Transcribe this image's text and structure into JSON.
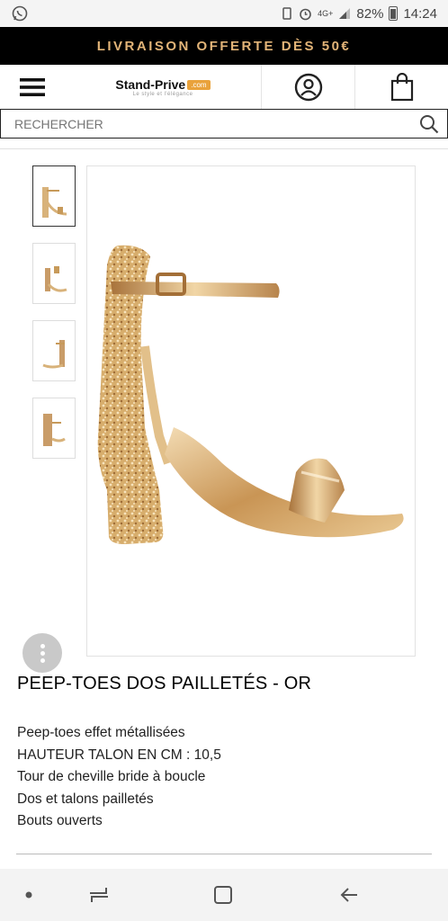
{
  "status_bar": {
    "battery": "82%",
    "time": "14:24",
    "network": "4G+"
  },
  "promo": {
    "text": "LIVRAISON OFFERTE DÈS 50€"
  },
  "header": {
    "logo_name": "Stand-Prive",
    "logo_badge": ".com",
    "logo_tagline": "Le style et l'élégance"
  },
  "search": {
    "placeholder": "RECHERCHER"
  },
  "gallery": {
    "thumbnail_count": 4,
    "image_alt": "gold glitter heel sandal"
  },
  "product": {
    "title": "PEEP-TOES DOS PAILLETÉS - OR",
    "description": [
      "Peep-toes effet métallisées",
      "HAUTEUR TALON EN CM : 10,5",
      "Tour de cheville bride à boucle",
      "Dos et talons pailletés",
      "Bouts ouverts"
    ]
  },
  "colors": {
    "promo_bg": "#000000",
    "promo_text": "#e2b478",
    "logo_badge": "#e9a23b",
    "shoe_gold": "#d8b27a"
  },
  "icons": {
    "menu": "hamburger-icon",
    "account": "user-circle-icon",
    "cart": "shopping-bag-icon",
    "search": "search-icon",
    "more": "more-vertical-icon"
  }
}
